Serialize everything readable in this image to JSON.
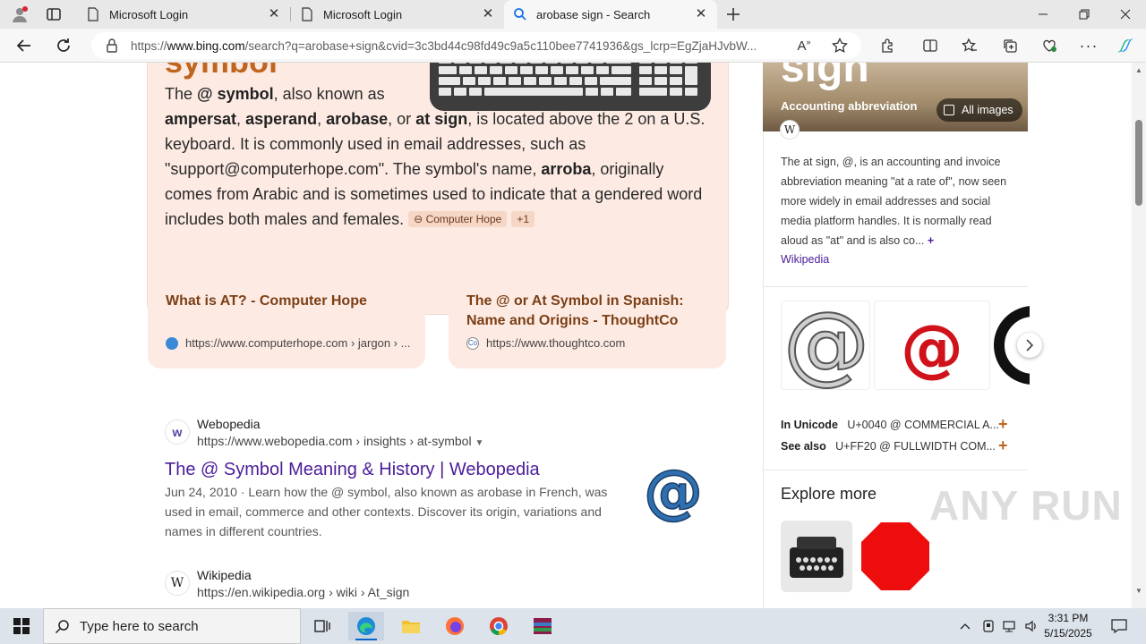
{
  "browser": {
    "tabs": [
      {
        "label": "Microsoft Login",
        "icon": "page-icon"
      },
      {
        "label": "Microsoft Login",
        "icon": "page-icon"
      },
      {
        "label": "arobase sign - Search",
        "icon": "search-icon"
      }
    ],
    "url_prefix": "https://",
    "url_domain": "www.bing.com",
    "url_rest": "/search?q=arobase+sign&cvid=3c3bd44c98fd49c9a5c110bee7741936&gs_lcrp=EgZjaHJvbW..."
  },
  "answer": {
    "heading_fragment": "symbol",
    "t1": "The ",
    "k1": "@ symbol",
    "t2": ", also known as ",
    "k2": "ampersat",
    "t3": ", ",
    "k3": "asperand",
    "t4": ", ",
    "k4": "arobase",
    "t5": ", or ",
    "k5": "at sign",
    "t6": ", is located above the 2 on a U.S. keyboard. It is commonly used in email addresses, such as \"support@computerhope.com\". The symbol's name, ",
    "k6": "arroba",
    "t7": ", originally comes from Arabic and is sometimes used to indicate that a gendered word includes both males and females.",
    "citation": "Computer Hope",
    "citation_more": "+1"
  },
  "cards": [
    {
      "title": "What is AT? - Computer Hope",
      "url": "https://www.computerhope.com › jargon › ..."
    },
    {
      "title": "The @ or At Symbol in Spanish: Name and Origins - ThoughtCo",
      "url": "https://www.thoughtco.com"
    }
  ],
  "results": [
    {
      "site": "Webopedia",
      "url": "https://www.webopedia.com › insights › at-symbol",
      "title": "The @ Symbol Meaning & History | Webopedia",
      "snippet_date": "Jun 24, 2010 · ",
      "snippet": "Learn how the @ symbol, also known as arobase in French, was used in email, commerce and other contexts. Discover its origin, variations and names in different countries."
    },
    {
      "site": "Wikipedia",
      "url": "https://en.wikipedia.org › wiki › At_sign"
    }
  ],
  "sidebar": {
    "hero_title": "sign",
    "hero_subtitle": "Accounting abbreviation",
    "all_images": "All images",
    "description": "The at sign, @, is an accounting and invoice abbreviation meaning \"at a rate of\", now seen more widely in email addresses and social media platform handles. It is normally read aloud as \"at\" and is also co...",
    "source_link": "Wikipedia",
    "facts": [
      {
        "label": "In Unicode",
        "value": "U+0040 @ COMMERCIAL A..."
      },
      {
        "label": "See also",
        "value": "U+FF20 @ FULLWIDTH COM..."
      }
    ],
    "explore_title": "Explore more"
  },
  "taskbar": {
    "search_placeholder": "Type here to search",
    "time": "3:31 PM",
    "date": "5/15/2025"
  },
  "watermark": "ANY RUN"
}
